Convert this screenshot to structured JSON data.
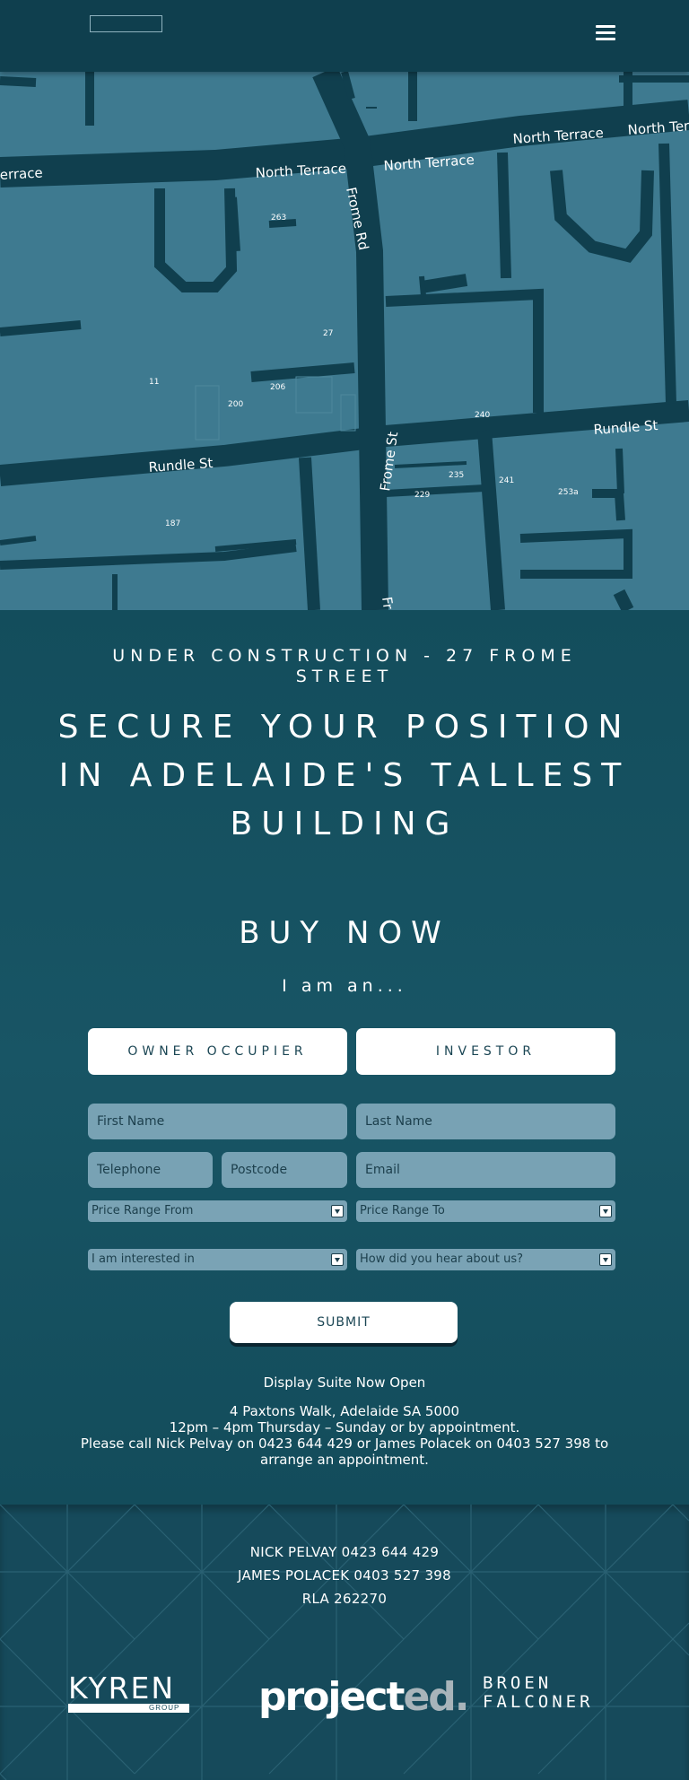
{
  "header": {
    "menu_icon": "hamburger-menu-icon"
  },
  "map": {
    "streets": {
      "north_terrace_left": "errace",
      "north_terrace_1": "North Terrace",
      "north_terrace_2": "North Terrace",
      "north_terrace_3": "North Terrace",
      "north_terrace_4": "North Terr",
      "frome_rd": "Frome Rd",
      "frome_st": "Frome St",
      "rundle_st_left": "Rundle St",
      "rundle_st_right": "Rundle St",
      "frome_bottom": "Fr"
    },
    "numbers": {
      "n263": "263",
      "n27": "27",
      "n11": "11",
      "n206": "206",
      "n200": "200",
      "n240": "240",
      "n235": "235",
      "n241": "241",
      "n229": "229",
      "n253a": "253a",
      "n187": "187"
    }
  },
  "hero": {
    "kicker": "UNDER CONSTRUCTION -  27 FROME STREET",
    "headline": "SECURE YOUR POSITION IN ADELAIDE'S TALLEST BUILDING",
    "buy_now": "BUY NOW",
    "i_am": "I am an..."
  },
  "form": {
    "owner_occupier": "OWNER OCCUPIER",
    "investor": "INVESTOR",
    "first_name_placeholder": "First Name",
    "last_name_placeholder": "Last Name",
    "telephone_placeholder": "Telephone",
    "postcode_placeholder": "Postcode",
    "email_placeholder": "Email",
    "price_from": "Price Range From",
    "price_to": "Price Range To",
    "interested_in": "I am interested in",
    "hear_about": "How did you hear about us?",
    "submit": "SUBMIT"
  },
  "info": {
    "display_suite": "Display Suite Now Open",
    "address": "4 Paxtons Walk, Adelaide SA 5000",
    "hours": "12pm – 4pm Thursday – Sunday or by appointment.",
    "call": "Please call Nick Pelvay on 0423 644 429 or James Polacek on 0403 527 398 to arrange an appointment."
  },
  "footer": {
    "contact_1": "NICK PELVAY   0423 644 429",
    "contact_2": "JAMES POLACEK   0403 527 398",
    "rla": "RLA 262270",
    "brand_kyren": "KYREN",
    "brand_kyren_sub": "GROUP",
    "brand_projected_1": "project",
    "brand_projected_2": "ed.",
    "brand_broen_1": "BROEN",
    "brand_broen_2": "FALCONER"
  },
  "colors": {
    "header_bg": "#0f3f4e",
    "map_block": "#3e7a90",
    "map_road": "#103f4e",
    "section_bg": "#164c5c",
    "field_bg": "#78a2b4",
    "accent_grey": "#a8b4ba"
  }
}
